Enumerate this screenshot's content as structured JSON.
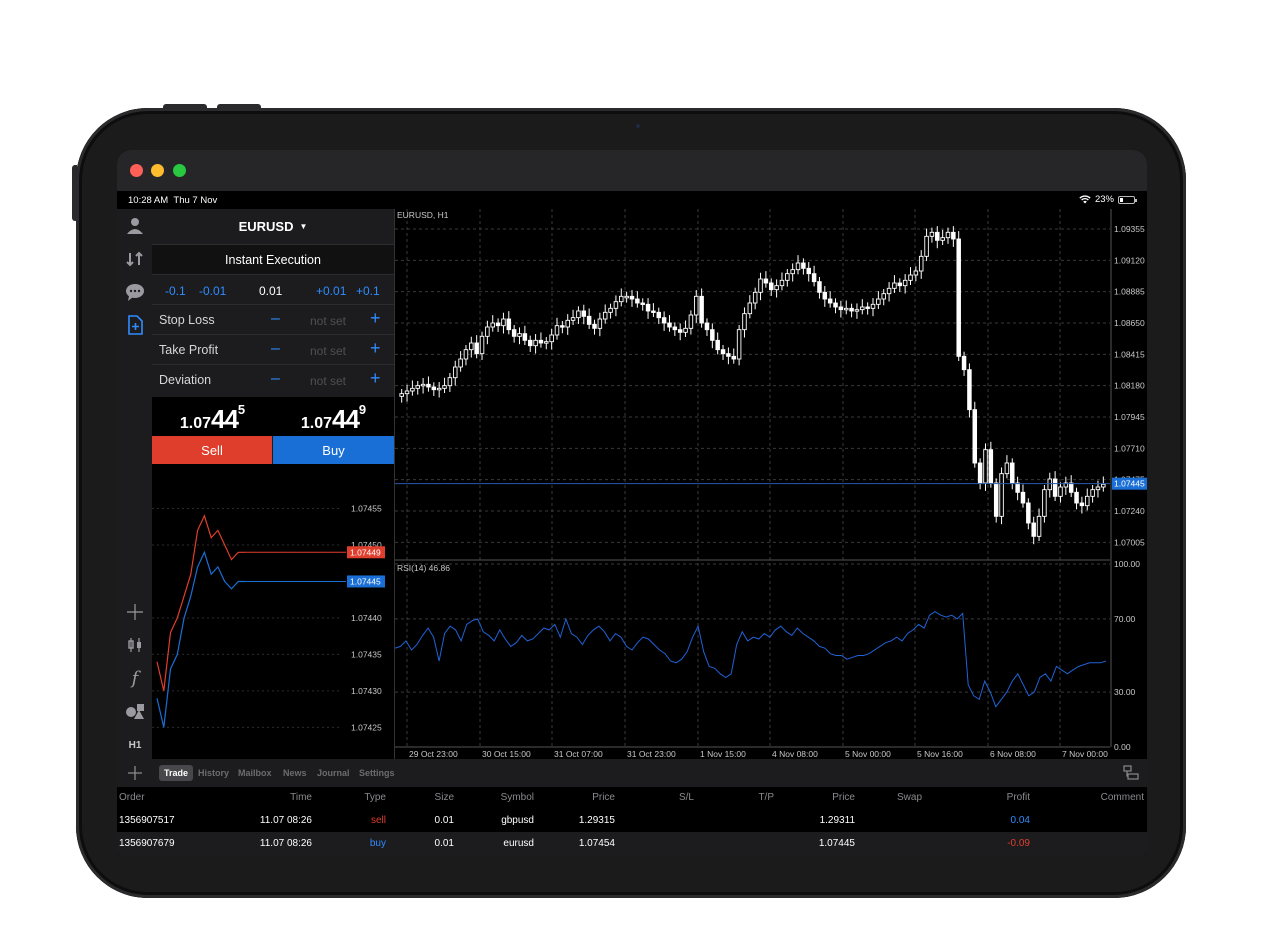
{
  "window": {
    "traffic_lights": [
      "#fe5f57",
      "#febc2e",
      "#28c840"
    ]
  },
  "status_bar": {
    "time": "10:28 AM",
    "date": "Thu 7 Nov",
    "battery": "23%",
    "battery_level": 0.23
  },
  "order": {
    "symbol": "EURUSD",
    "execution": "Instant Execution",
    "volume_steps": [
      "-0.1",
      "-0.01",
      "+0.01",
      "+0.1"
    ],
    "volume": "0.01",
    "params": [
      {
        "label": "Stop Loss",
        "value": "not set"
      },
      {
        "label": "Take Profit",
        "value": "not set"
      },
      {
        "label": "Deviation",
        "value": "not set"
      }
    ],
    "sell_price": {
      "small": "1.07",
      "big": "44",
      "tiny": "5"
    },
    "buy_price": {
      "small": "1.07",
      "big": "44",
      "tiny": "9"
    },
    "sell_label": "Sell",
    "buy_label": "Buy"
  },
  "tick_chart": {
    "y_labels": [
      "1.07455",
      "1.07450",
      "1.07440",
      "1.07435",
      "1.07430",
      "1.07425"
    ],
    "ask_tag": "1.07449",
    "bid_tag": "1.07445",
    "ask_color": "#e03e2d",
    "bid_color": "#1a6fd6"
  },
  "chart": {
    "title": "EURUSD, H1",
    "price_labels": [
      "1.09355",
      "1.09120",
      "1.08885",
      "1.08650",
      "1.08415",
      "1.08180",
      "1.07945",
      "1.07710",
      "1.07475",
      "1.07240",
      "1.07005"
    ],
    "current_price": "1.07445",
    "time_labels": [
      "29 Oct 23:00",
      "30 Oct 15:00",
      "31 Oct 07:00",
      "31 Oct 23:00",
      "1 Nov 15:00",
      "4 Nov 08:00",
      "5 Nov 00:00",
      "5 Nov 16:00",
      "6 Nov 08:00",
      "7 Nov 00:00"
    ],
    "rsi_title": "RSI(14) 46.86",
    "rsi_labels": [
      "100.00",
      "70.00",
      "30.00",
      "0.00"
    ],
    "rsi_color": "#2162d6"
  },
  "chart_data": {
    "type": "candlestick",
    "title": "EURUSD, H1",
    "ylim": [
      1.0688,
      1.0946
    ],
    "grid": true,
    "close_series": [
      1.0812,
      1.0814,
      1.0816,
      1.0818,
      1.0819,
      1.0817,
      1.0815,
      1.0816,
      1.0818,
      1.0824,
      1.0832,
      1.0838,
      1.0845,
      1.085,
      1.0842,
      1.0855,
      1.0862,
      1.0865,
      1.0863,
      1.0868,
      1.086,
      1.0855,
      1.0857,
      1.0852,
      1.0848,
      1.0852,
      1.085,
      1.0851,
      1.0856,
      1.0863,
      1.0862,
      1.0867,
      1.0869,
      1.0874,
      1.087,
      1.0864,
      1.0861,
      1.0868,
      1.0873,
      1.0876,
      1.0881,
      1.0885,
      1.0885,
      1.0883,
      1.088,
      1.0879,
      1.0874,
      1.0873,
      1.0869,
      1.0865,
      1.0862,
      1.086,
      1.0858,
      1.0861,
      1.0871,
      1.0885,
      1.0865,
      1.086,
      1.0852,
      1.0845,
      1.0842,
      1.084,
      1.0838,
      1.086,
      1.0872,
      1.088,
      1.0888,
      1.0898,
      1.0895,
      1.089,
      1.0893,
      1.0897,
      1.0902,
      1.0905,
      1.091,
      1.0906,
      1.0902,
      1.0896,
      1.0888,
      1.0883,
      1.088,
      1.0877,
      1.0875,
      1.0876,
      1.0874,
      1.0875,
      1.0877,
      1.0876,
      1.0879,
      1.0883,
      1.0887,
      1.0891,
      1.0895,
      1.0893,
      1.0897,
      1.0901,
      1.0904,
      1.0915,
      1.093,
      1.0933,
      1.0927,
      1.0929,
      1.0933,
      1.0928,
      1.084,
      1.083,
      1.08,
      1.076,
      1.0745,
      1.077,
      1.0745,
      1.072,
      1.0752,
      1.076,
      1.0745,
      1.0738,
      1.073,
      1.0715,
      1.0705,
      1.072,
      1.074,
      1.0748,
      1.0735,
      1.0742,
      1.0745,
      1.0738,
      1.073,
      1.0728,
      1.0735,
      1.074,
      1.0742,
      1.0744
    ],
    "rsi_series": [
      54,
      55,
      58,
      53,
      56,
      61,
      65,
      60,
      47,
      62,
      66,
      64,
      58,
      67,
      69,
      70,
      63,
      61,
      58,
      64,
      59,
      55,
      57,
      61,
      58,
      59,
      62,
      65,
      64,
      67,
      60,
      70,
      62,
      60,
      56,
      61,
      64,
      66,
      63,
      58,
      62,
      60,
      55,
      53,
      57,
      60,
      59,
      56,
      53,
      51,
      47,
      46,
      48,
      52,
      60,
      66,
      52,
      44,
      43,
      40,
      38,
      40,
      56,
      63,
      58,
      60,
      59,
      62,
      60,
      64,
      66,
      63,
      61,
      65,
      62,
      60,
      58,
      55,
      54,
      51,
      50,
      50,
      48,
      49,
      50,
      50,
      51,
      53,
      55,
      57,
      58,
      60,
      58,
      62,
      64,
      67,
      65,
      72,
      74,
      72,
      71,
      72,
      70,
      73,
      34,
      28,
      26,
      36,
      30,
      22,
      26,
      30,
      36,
      40,
      34,
      28,
      30,
      38,
      40,
      36,
      44,
      42,
      40,
      42,
      44,
      45,
      46,
      46,
      46,
      47
    ],
    "tick_ask": [
      1.07434,
      1.0743,
      1.07438,
      1.0744,
      1.07443,
      1.07446,
      1.07452,
      1.07454,
      1.07451,
      1.07452,
      1.0745,
      1.07448,
      1.07449,
      1.07449
    ],
    "tick_bid": [
      1.07429,
      1.07425,
      1.07433,
      1.07435,
      1.0744,
      1.07443,
      1.07447,
      1.07449,
      1.07446,
      1.07447,
      1.07445,
      1.07444,
      1.07445,
      1.07445
    ]
  },
  "tabs": [
    {
      "label": "Trade",
      "active": true
    },
    {
      "label": "History",
      "active": false
    },
    {
      "label": "Mailbox",
      "active": false
    },
    {
      "label": "News",
      "active": false
    },
    {
      "label": "Journal",
      "active": false
    },
    {
      "label": "Settings",
      "active": false
    }
  ],
  "table": {
    "headers": [
      "Order",
      "Time",
      "Type",
      "Size",
      "Symbol",
      "Price",
      "S/L",
      "T/P",
      "Price",
      "Swap",
      "Profit",
      "Comment"
    ],
    "rows": [
      {
        "order": "1356907517",
        "time": "11.07 08:26",
        "type": "sell",
        "size": "0.01",
        "symbol": "gbpusd",
        "price": "1.29315",
        "sl": "",
        "tp": "",
        "price2": "1.29311",
        "swap": "",
        "profit": "0.04",
        "comment": ""
      },
      {
        "order": "1356907679",
        "time": "11.07 08:26",
        "type": "buy",
        "size": "0.01",
        "symbol": "eurusd",
        "price": "1.07454",
        "sl": "",
        "tp": "",
        "price2": "1.07445",
        "swap": "",
        "profit": "-0.09",
        "comment": ""
      }
    ]
  }
}
